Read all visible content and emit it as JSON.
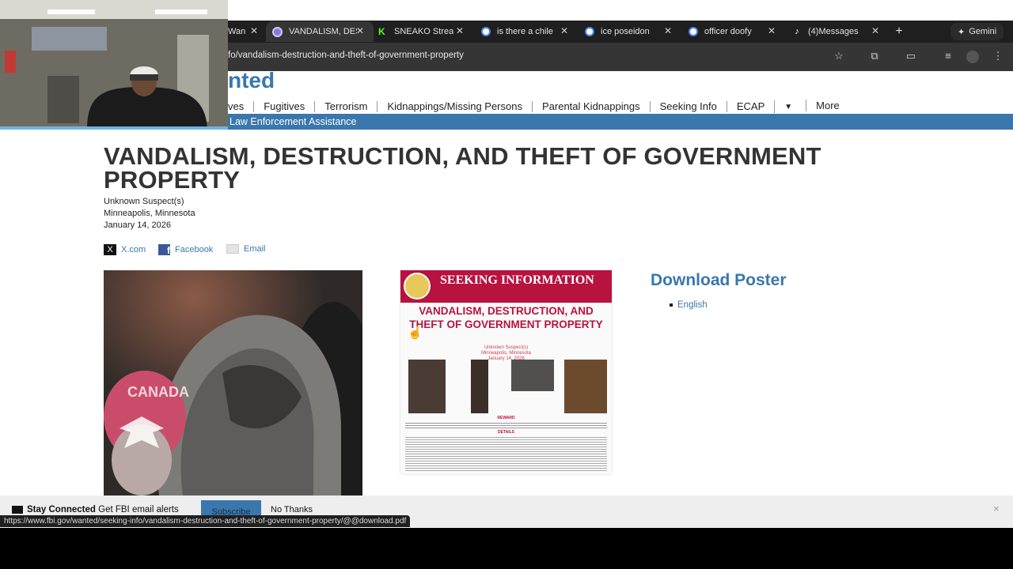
{
  "browser": {
    "tabs": [
      {
        "title": "Wan",
        "favicon_color": "#7a7a7a"
      },
      {
        "title": "VANDALISM, DES",
        "favicon_color": "#8a7ad8",
        "active": true
      },
      {
        "title": "SNEAKO Strea",
        "favicon_color": "#53fc18"
      },
      {
        "title": "is there a chile",
        "favicon_color": "#4285f4"
      },
      {
        "title": "ice poseidon",
        "favicon_color": "#4285f4"
      },
      {
        "title": "officer doofy",
        "favicon_color": "#4285f4"
      },
      {
        "title": "(4)Messages",
        "favicon_color": "#ffffff"
      }
    ],
    "gemini_label": "Gemini",
    "url": "fo/vandalism-destruction-and-theft-of-government-property",
    "status_url": "https://www.fbi.gov/wanted/seeking-info/vandalism-destruction-and-theft-of-government-property/@@download.pdf"
  },
  "site": {
    "brand_fragment": "nted",
    "nav": [
      "ves",
      "Fugitives",
      "Terrorism",
      "Kidnappings/Missing Persons",
      "Parental Kidnappings",
      "Seeking Info",
      "ECAP",
      "More"
    ],
    "subnav": "Law Enforcement Assistance"
  },
  "case": {
    "title": "VANDALISM, DESTRUCTION, AND THEFT OF GOVERNMENT PROPERTY",
    "suspect": "Unknown Suspect(s)",
    "location": "Minneapolis, Minnesota",
    "date": "January 14, 2026"
  },
  "share": {
    "x": "X.com",
    "facebook": "Facebook",
    "email": "Email"
  },
  "poster": {
    "header": "SEEKING INFORMATION",
    "title": "VANDALISM, DESTRUCTION, AND THEFT OF GOVERNMENT PROPERTY",
    "sub1": "Unknown Suspect(s)",
    "sub2": "Minneapolis, Minnesota",
    "sub3": "January 14, 2026",
    "reward_label": "REWARD",
    "details_label": "DETAILS"
  },
  "photo": {
    "hat_text": "CANADA"
  },
  "download": {
    "title": "Download Poster",
    "item": "English"
  },
  "banner": {
    "bold": "Stay Connected",
    "text": "Get FBI email alerts",
    "subscribe": "Subscribe",
    "no_thanks": "No Thanks",
    "close": "×"
  },
  "colors": {
    "fbi_blue": "#3a77ad",
    "poster_red": "#b8123f"
  }
}
